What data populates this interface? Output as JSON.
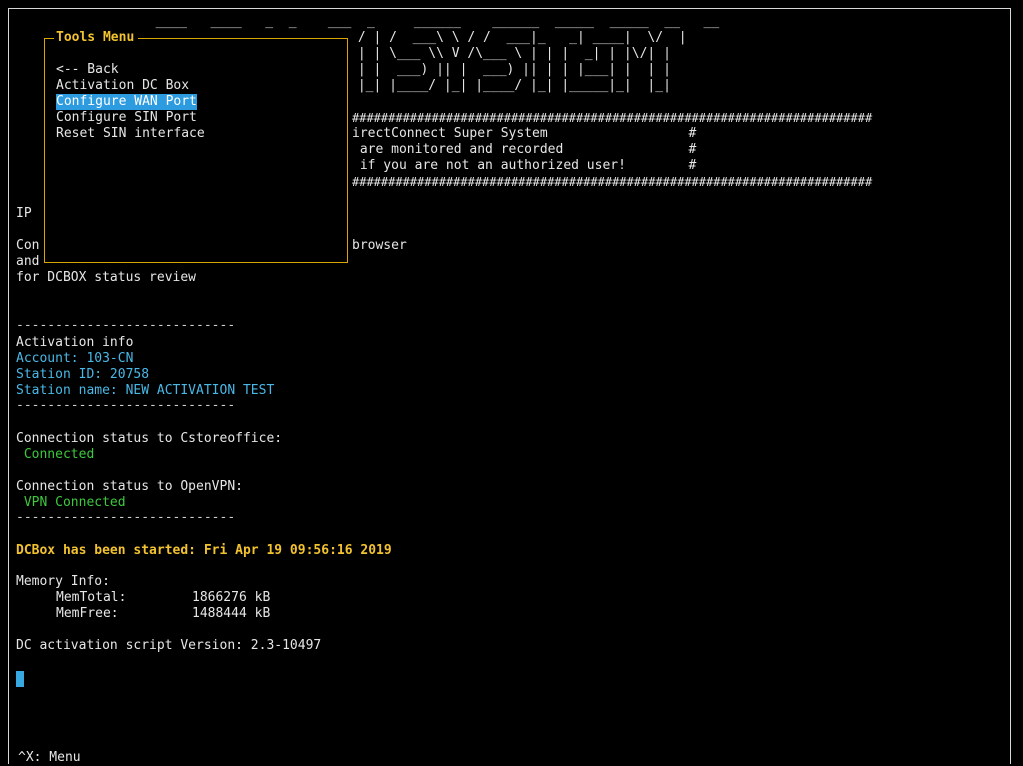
{
  "banner": {
    "ascii_art": [
      "  ____   ____   _  _    ___  _     ______    ______  _____  _____  __   __",
      " / | /  ___\\ \\ / /  ___|_   _| ____|  \\/  |",
      " | | \\___ \\\\ V /\\___ \\ | | |  _| | |\\/| |",
      " | |  ___) || |  ___) || | | |___| |  | |",
      " |_| |____/ |_| |____/ |_| |_____|_|  |_|"
    ],
    "hash_line": "########################################################################",
    "warning_lines": [
      "irectConnect Super System                  #",
      " are monitored and recorded                #",
      " if you are not an authorized user!        #"
    ]
  },
  "background_text": {
    "ip_fragment": "IP",
    "con_fragment": "Con",
    "browser_fragment": "browser",
    "and_fragment": "and",
    "status_review": "for DCBOX status review"
  },
  "separator": "----------------------------",
  "activation": {
    "heading": "Activation info",
    "account": "Account: 103-CN",
    "station_id": "Station ID: 20758",
    "station_name": "Station name: NEW ACTIVATION TEST"
  },
  "connections": {
    "cstore_label": "Connection status to Cstoreoffice:",
    "cstore_value": " Connected",
    "vpn_label": "Connection status to OpenVPN:",
    "vpn_value": " VPN Connected"
  },
  "dcbox_started": "DCBox has been started: Fri Apr 19 09:56:16 2019",
  "memory": {
    "heading": "Memory Info:",
    "total_label": "MemTotal:",
    "total_value": "1866276 kB",
    "free_label": "MemFree:",
    "free_value": "1488444 kB"
  },
  "script_version": "DC activation script Version: 2.3-10497",
  "tools_menu": {
    "title": "Tools Menu",
    "items": [
      {
        "label": "<-- Back",
        "selected": false
      },
      {
        "label": "Activation DC Box",
        "selected": false
      },
      {
        "label": "Configure WAN Port",
        "selected": true
      },
      {
        "label": "Configure SIN Port",
        "selected": false
      },
      {
        "label": "Reset SIN interface",
        "selected": false
      }
    ]
  },
  "footer": {
    "hint": "^X: Menu"
  },
  "colors": {
    "accent_cyan": "#49b8e6",
    "status_green": "#3ec83e",
    "highlight_yellow": "#f2c230",
    "menu_border": "#d9a700",
    "selection_blue": "#2c9be0"
  }
}
